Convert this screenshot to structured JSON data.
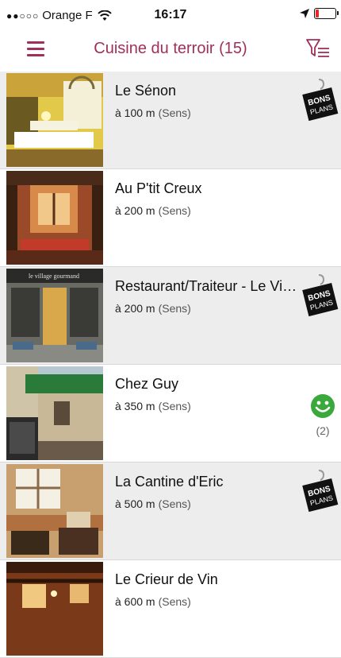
{
  "status_bar": {
    "signal_dots": "●●○○○",
    "carrier": "Orange F",
    "time": "16:17",
    "battery_level": 0.15,
    "colors": {
      "battery_low": "#e8262c"
    }
  },
  "header": {
    "title": "Cuisine du terroir (15)",
    "menu_icon": "hamburger-icon",
    "filter_icon": "filter-list-icon",
    "accent_color": "#a0305a"
  },
  "restaurants": [
    {
      "name": "Le Sénon",
      "distance": "à 100 m",
      "town": "(Sens)",
      "badge": "bons-plans",
      "photo": "dining-room-yellow"
    },
    {
      "name": "Au P'tit Creux",
      "distance": "à 200 m",
      "town": "(Sens)",
      "badge": "none",
      "photo": "dining-room-timber"
    },
    {
      "name": "Restaurant/Traiteur - Le Village Gourmand",
      "distance": "à 200 m",
      "town": "(Sens)",
      "badge": "bons-plans",
      "photo": "storefront",
      "sign_text": "le village gourmand"
    },
    {
      "name": "Chez Guy",
      "distance": "à 350 m",
      "town": "(Sens)",
      "badge": "smiley",
      "rating_count": "(2)",
      "photo": "terrace"
    },
    {
      "name": "La Cantine d'Eric",
      "distance": "à 500 m",
      "town": "(Sens)",
      "badge": "bons-plans",
      "photo": "dining-room-windows"
    },
    {
      "name": "Le Crieur de Vin",
      "distance": "à 600 m",
      "town": "(Sens)",
      "badge": "none",
      "photo": "dining-room-beams"
    }
  ],
  "badges": {
    "bons_plans_line1": "BONS",
    "bons_plans_line2": "PLANS"
  }
}
